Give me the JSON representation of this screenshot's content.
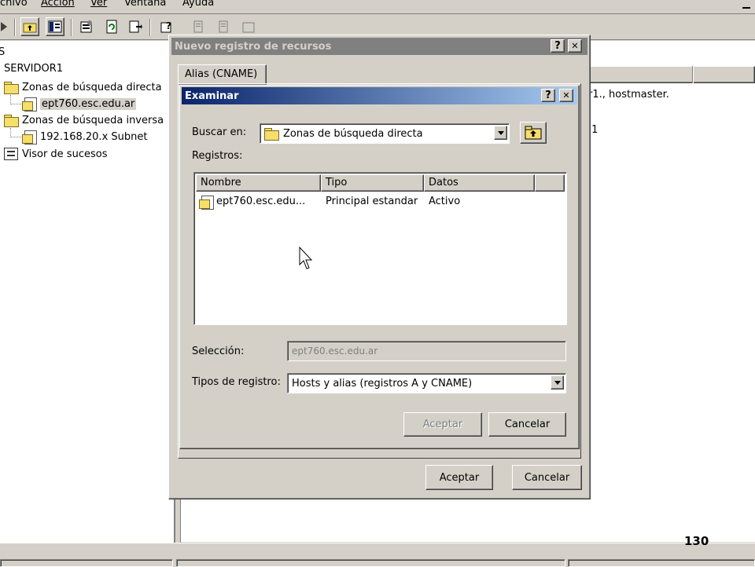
{
  "menu": {
    "archivo": "chivo",
    "accion": "Acción",
    "ver": "Ver",
    "ventana": "Ventana",
    "ayuda": "Ayuda"
  },
  "tree": {
    "root_fragment": "S",
    "server": "SERVIDOR1",
    "forward_zones": "Zonas de búsqueda directa",
    "forward_zone_item": "ept760.esc.edu.ar",
    "reverse_zones": "Zonas de búsqueda inversa",
    "reverse_zone_item": "192.168.20.x Subnet",
    "event_viewer": "Visor de sucesos"
  },
  "background_list": {
    "row1": "r1., hostmaster.",
    "row2": ".1"
  },
  "outer_dialog": {
    "title": "Nuevo registro de recursos",
    "help": "?",
    "close": "✕",
    "tab": "Alias (CNAME)",
    "ok": "Aceptar",
    "cancel": "Cancelar"
  },
  "browse_dialog": {
    "title": "Examinar",
    "help": "?",
    "close": "✕",
    "look_in_label": "Buscar en:",
    "look_in_value": "Zonas de búsqueda directa",
    "records_label": "Registros:",
    "columns": {
      "name": "Nombre",
      "type": "Tipo",
      "data": "Datos"
    },
    "rows": [
      {
        "name": "ept760.esc.edu...",
        "type": "Principal estandar",
        "data": "Activo"
      }
    ],
    "selection_label": "Selección:",
    "selection_value": "ept760.esc.edu.ar",
    "record_types_label": "Tipos de registro:",
    "record_types_value": "Hosts y alias (registros A y CNAME)",
    "ok": "Aceptar",
    "cancel": "Cancelar"
  },
  "slide_number": "130",
  "colors": {
    "face": "#d4d0c8",
    "active_title": "#0a246a",
    "folder": "#f6de6a"
  }
}
